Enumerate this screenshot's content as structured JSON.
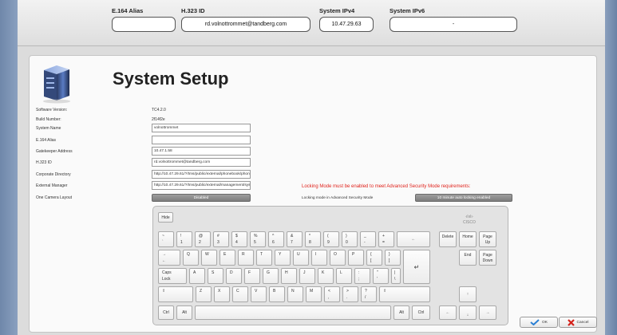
{
  "top": {
    "alias_label": "E.164 Alias",
    "alias_value": "",
    "h323_label": "H.323 ID",
    "h323_value": "rd.volnottrommet@tandberg.com",
    "ipv4_label": "System IPv4",
    "ipv4_value": "10.47.29.63",
    "ipv6_label": "System IPv6",
    "ipv6_value": "-"
  },
  "page_title": "System Setup",
  "fields": [
    {
      "label": "Software Version:",
      "value": "TC4.2.0"
    },
    {
      "label": "Build Number:",
      "value": "2f14f2e"
    },
    {
      "label": "System Name",
      "value": "volnottrommet"
    },
    {
      "label": "E.164 Alias",
      "value": ""
    },
    {
      "label": "Gatekeeper Address",
      "value": "10.47.1.58"
    },
    {
      "label": "H.323 ID",
      "value": "rd.volnottrommet@tandberg.com"
    },
    {
      "label": "Corporate Directory",
      "value": "http://10.47.29.61/?/tms/public/external/phonebook/phon"
    },
    {
      "label": "External Manager",
      "value": "http://10.47.29.61/?/tms/public/external/management/sys"
    },
    {
      "label": "One Camera Layout",
      "value": "Disabled"
    }
  ],
  "warning": "Locking Mode must be enabled to meet Advanced Security Mode requirements:",
  "lock_label": "Locking mode in Advanced Security Mode",
  "lock_value": "10 minute auto locking enabled",
  "keyboard": {
    "hide": "Hide",
    "brand_top": "·ılıılı·",
    "brand_bottom": "CISCO",
    "row1": [
      {
        "t": "~",
        "b": "`"
      },
      {
        "t": "!",
        "b": "1"
      },
      {
        "t": "@",
        "b": "2"
      },
      {
        "t": "#",
        "b": "3"
      },
      {
        "t": "$",
        "b": "4"
      },
      {
        "t": "%",
        "b": "5"
      },
      {
        "t": "^",
        "b": "6"
      },
      {
        "t": "&",
        "b": "7"
      },
      {
        "t": "*",
        "b": "8"
      },
      {
        "t": "(",
        "b": "9"
      },
      {
        "t": ")",
        "b": "0"
      },
      {
        "t": "_",
        "b": "-"
      },
      {
        "t": "+",
        "b": "="
      }
    ],
    "backspace": "←",
    "row2": [
      "Q",
      "W",
      "E",
      "R",
      "T",
      "Y",
      "U",
      "I",
      "O",
      "P"
    ],
    "row2_br1": {
      "t": "{",
      "b": "["
    },
    "row2_br2": {
      "t": "}",
      "b": "]"
    },
    "tab_t": "→",
    "tab_b": "←",
    "enter": "↵",
    "caps": {
      "t": "Caps",
      "b": "Lock"
    },
    "row3": [
      "A",
      "S",
      "D",
      "F",
      "G",
      "H",
      "J",
      "K",
      "L"
    ],
    "row3_semi": {
      "t": ":",
      "b": ";"
    },
    "row3_quote": {
      "t": "\"",
      "b": "'"
    },
    "row3_pipe": {
      "t": "|",
      "b": "\\"
    },
    "shift_l": "⇧",
    "shift_r": "⇧",
    "row4": [
      "Z",
      "X",
      "C",
      "V",
      "B",
      "N",
      "M"
    ],
    "row4_lt": {
      "t": "<",
      "b": ","
    },
    "row4_gt": {
      "t": ">",
      "b": "."
    },
    "row4_q": {
      "t": "?",
      "b": "/"
    },
    "ctrl_l": "Ctrl",
    "alt_l": "Alt",
    "alt_r": "Alt",
    "ctrl_r": "Ctrl",
    "delete": "Delete",
    "home": "Home",
    "pgup_t": "Page",
    "pgup_b": "Up",
    "end": "End",
    "pgdn_t": "Page",
    "pgdn_b": "Down",
    "up": "↑",
    "left": "←",
    "down": "↓",
    "right": "→"
  },
  "ok_label": "OK",
  "cancel_label": "Cancel"
}
